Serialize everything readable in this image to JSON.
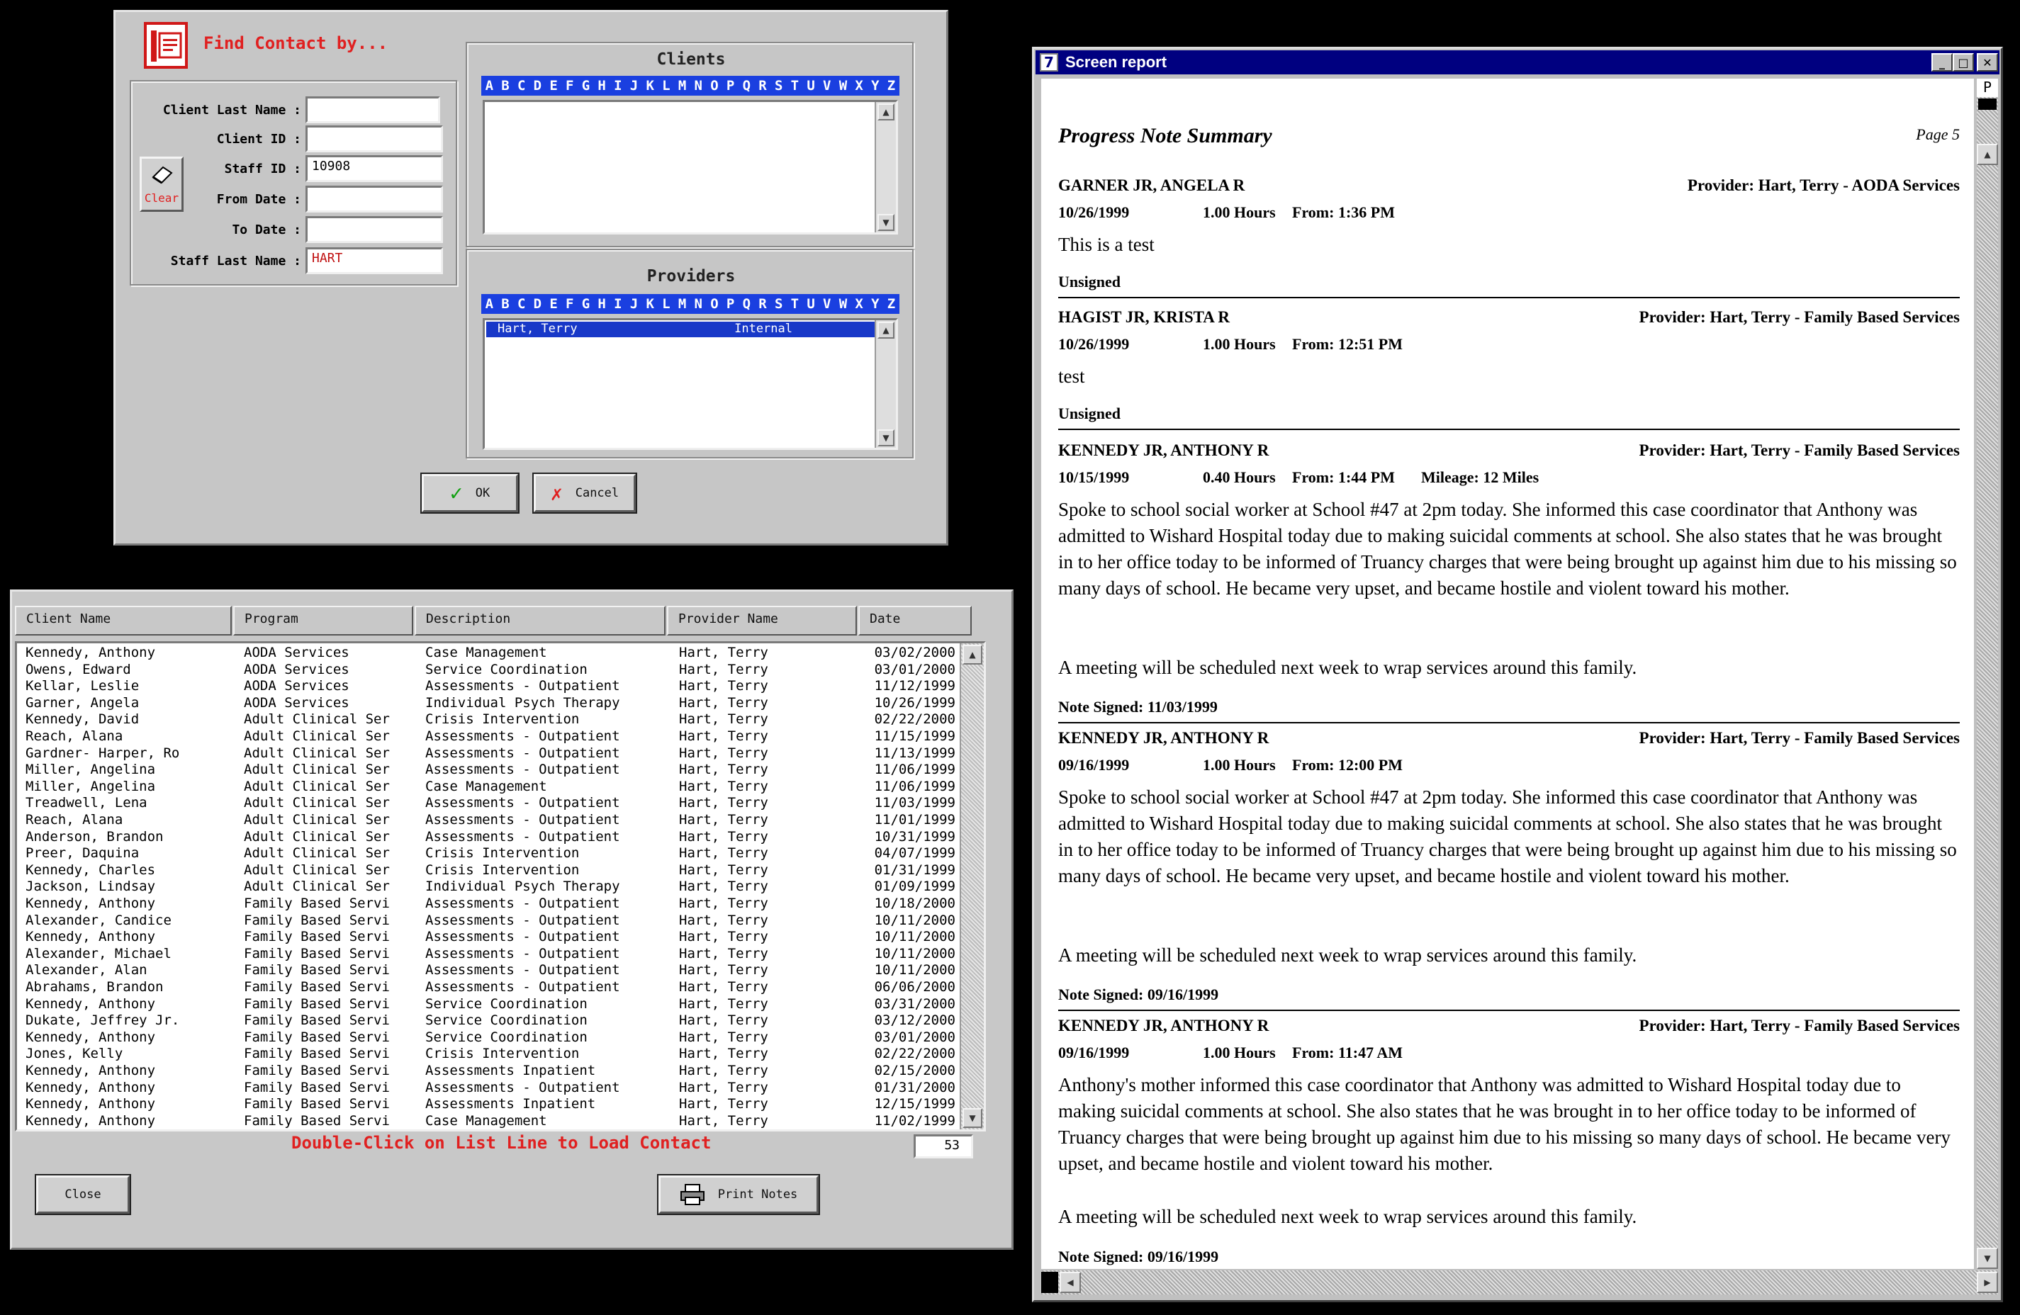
{
  "find": {
    "title": "Find Contact by...",
    "labels": {
      "client_last_name": "Client Last Name :",
      "client_id": "Client ID :",
      "staff_id": "Staff ID :",
      "from_date": "From Date :",
      "to_date": "To Date :",
      "staff_last_name": "Staff Last Name :"
    },
    "values": {
      "client_last_name": "",
      "client_id": "",
      "staff_id": "10908",
      "from_date": "",
      "to_date": "",
      "staff_last_name": "HART"
    },
    "clear_label": "Clear",
    "clients_title": "Clients",
    "providers_title": "Providers",
    "alphabet": [
      "A",
      "B",
      "C",
      "D",
      "E",
      "F",
      "G",
      "H",
      "I",
      "J",
      "K",
      "L",
      "M",
      "N",
      "O",
      "P",
      "Q",
      "R",
      "S",
      "T",
      "U",
      "V",
      "W",
      "X",
      "Y",
      "Z"
    ],
    "providers": [
      {
        "name": "Hart, Terry",
        "type": "Internal"
      }
    ],
    "ok_label": "OK",
    "cancel_label": "Cancel"
  },
  "list": {
    "headers": [
      "Client Name",
      "Program",
      "Description",
      "Provider Name",
      "Date"
    ],
    "rows": [
      [
        "Kennedy, Anthony",
        "AODA Services",
        "Case Management",
        "Hart, Terry",
        "03/02/2000"
      ],
      [
        "Owens, Edward",
        "AODA Services",
        "Service Coordination",
        "Hart, Terry",
        "03/01/2000"
      ],
      [
        "Kellar, Leslie",
        "AODA Services",
        "Assessments - Outpatient",
        "Hart, Terry",
        "11/12/1999"
      ],
      [
        "Garner, Angela",
        "AODA Services",
        "Individual Psych Therapy",
        "Hart, Terry",
        "10/26/1999"
      ],
      [
        "Kennedy, David",
        "Adult Clinical Ser",
        "Crisis Intervention",
        "Hart, Terry",
        "02/22/2000"
      ],
      [
        "Reach, Alana",
        "Adult Clinical Ser",
        "Assessments - Outpatient",
        "Hart, Terry",
        "11/15/1999"
      ],
      [
        "Gardner- Harper, Ro",
        "Adult Clinical Ser",
        "Assessments - Outpatient",
        "Hart, Terry",
        "11/13/1999"
      ],
      [
        "Miller, Angelina",
        "Adult Clinical Ser",
        "Assessments - Outpatient",
        "Hart, Terry",
        "11/06/1999"
      ],
      [
        "Miller, Angelina",
        "Adult Clinical Ser",
        "Case Management",
        "Hart, Terry",
        "11/06/1999"
      ],
      [
        "Treadwell, Lena",
        "Adult Clinical Ser",
        "Assessments - Outpatient",
        "Hart, Terry",
        "11/03/1999"
      ],
      [
        "Reach, Alana",
        "Adult Clinical Ser",
        "Assessments - Outpatient",
        "Hart, Terry",
        "11/01/1999"
      ],
      [
        "Anderson, Brandon",
        "Adult Clinical Ser",
        "Assessments - Outpatient",
        "Hart, Terry",
        "10/31/1999"
      ],
      [
        "Preer, Daquina",
        "Adult Clinical Ser",
        "Crisis Intervention",
        "Hart, Terry",
        "04/07/1999"
      ],
      [
        "Kennedy, Charles",
        "Adult Clinical Ser",
        "Crisis Intervention",
        "Hart, Terry",
        "01/31/1999"
      ],
      [
        "Jackson, Lindsay",
        "Adult Clinical Ser",
        "Individual Psych Therapy",
        "Hart, Terry",
        "01/09/1999"
      ],
      [
        "Kennedy, Anthony",
        "Family Based Servi",
        "Assessments - Outpatient",
        "Hart, Terry",
        "10/18/2000"
      ],
      [
        "Alexander, Candice",
        "Family Based Servi",
        "Assessments - Outpatient",
        "Hart, Terry",
        "10/11/2000"
      ],
      [
        "Kennedy, Anthony",
        "Family Based Servi",
        "Assessments - Outpatient",
        "Hart, Terry",
        "10/11/2000"
      ],
      [
        "Alexander, Michael",
        "Family Based Servi",
        "Assessments - Outpatient",
        "Hart, Terry",
        "10/11/2000"
      ],
      [
        "Alexander, Alan",
        "Family Based Servi",
        "Assessments - Outpatient",
        "Hart, Terry",
        "10/11/2000"
      ],
      [
        "Abrahams, Brandon",
        "Family Based Servi",
        "Assessments - Outpatient",
        "Hart, Terry",
        "06/06/2000"
      ],
      [
        "Kennedy, Anthony",
        "Family Based Servi",
        "Service Coordination",
        "Hart, Terry",
        "03/31/2000"
      ],
      [
        "Dukate, Jeffrey Jr.",
        "Family Based Servi",
        "Service Coordination",
        "Hart, Terry",
        "03/12/2000"
      ],
      [
        "Kennedy, Anthony",
        "Family Based Servi",
        "Service Coordination",
        "Hart, Terry",
        "03/01/2000"
      ],
      [
        "Jones, Kelly",
        "Family Based Servi",
        "Crisis Intervention",
        "Hart, Terry",
        "02/22/2000"
      ],
      [
        "Kennedy, Anthony",
        "Family Based Servi",
        "Assessments Inpatient",
        "Hart, Terry",
        "02/15/2000"
      ],
      [
        "Kennedy, Anthony",
        "Family Based Servi",
        "Assessments - Outpatient",
        "Hart, Terry",
        "01/31/2000"
      ],
      [
        "Kennedy, Anthony",
        "Family Based Servi",
        "Assessments Inpatient",
        "Hart, Terry",
        "12/15/1999"
      ],
      [
        "Kennedy, Anthony",
        "Family Based Servi",
        "Case Management",
        "Hart, Terry",
        "11/02/1999"
      ]
    ],
    "hint": "Double-Click on List Line to Load Contact",
    "count": "53",
    "close_label": "Close",
    "print_label": "Print Notes"
  },
  "report": {
    "window_title": "Screen report",
    "heading": "Progress Note Summary",
    "page": "Page 5",
    "ruler_letter": "P",
    "entries": [
      {
        "client": "GARNER JR, ANGELA R",
        "provider": "Provider: Hart, Terry - AODA Services",
        "date": "10/26/1999",
        "hours": "1.00 Hours",
        "from": "From:  1:36 PM",
        "mileage": "",
        "paragraphs": [
          "This is a test"
        ],
        "signed": "Unsigned"
      },
      {
        "client": "HAGIST JR, KRISTA R",
        "provider": "Provider: Hart, Terry - Family Based Services",
        "date": "10/26/1999",
        "hours": "1.00 Hours",
        "from": "From:  12:51 PM",
        "mileage": "",
        "paragraphs": [
          "test"
        ],
        "signed": "Unsigned"
      },
      {
        "client": "KENNEDY JR, ANTHONY R",
        "provider": "Provider: Hart, Terry - Family Based Services",
        "date": "10/15/1999",
        "hours": "0.40 Hours",
        "from": "From:  1:44 PM",
        "mileage": "Mileage: 12 Miles",
        "paragraphs": [
          "Spoke to  school social worker at School #47 at 2pm today.  She informed this case coordinator that Anthony was admitted to Wishard Hospital today due to making suicidal comments at school.  She also states that he was brought in to her office today to be informed of Truancy charges that were being brought up against him due to his missing so many days of school.  He became very upset, and became hostile and violent toward his mother.",
          "A meeting will be scheduled next week to wrap services around this family."
        ],
        "signed": "Note Signed: 11/03/1999"
      },
      {
        "client": "KENNEDY JR, ANTHONY R",
        "provider": "Provider: Hart, Terry - Family Based Services",
        "date": "09/16/1999",
        "hours": "1.00 Hours",
        "from": "From:  12:00 PM",
        "mileage": "",
        "paragraphs": [
          "Spoke to  school social worker at School #47 at 2pm today.  She informed this case coordinator that Anthony was admitted to Wishard Hospital today due to making suicidal comments at school.  She also states that he was brought in to her office today to be informed of Truancy charges that were being brought up against him due to his missing so many days of school.  He became very upset, and became hostile and violent toward his mother.",
          "A meeting will be scheduled next week to wrap services around this family."
        ],
        "signed": "Note Signed: 09/16/1999"
      },
      {
        "client": "KENNEDY JR, ANTHONY R",
        "provider": "Provider: Hart, Terry - Family Based Services",
        "date": "09/16/1999",
        "hours": "1.00 Hours",
        "from": "From:  11:47 AM",
        "mileage": "",
        "paragraphs": [
          "Anthony's mother informed this case coordinator that Anthony was admitted to Wishard Hospital today due to making suicidal comments at school.  She also states that he was brought in to her office today to be informed of Truancy charges that were being brought up against him due to his missing so many days of school.  He became very upset, and became hostile and violent toward his mother.",
          "A meeting will be scheduled next week to wrap services around this family."
        ],
        "signed": "Note Signed: 09/16/1999"
      }
    ]
  }
}
